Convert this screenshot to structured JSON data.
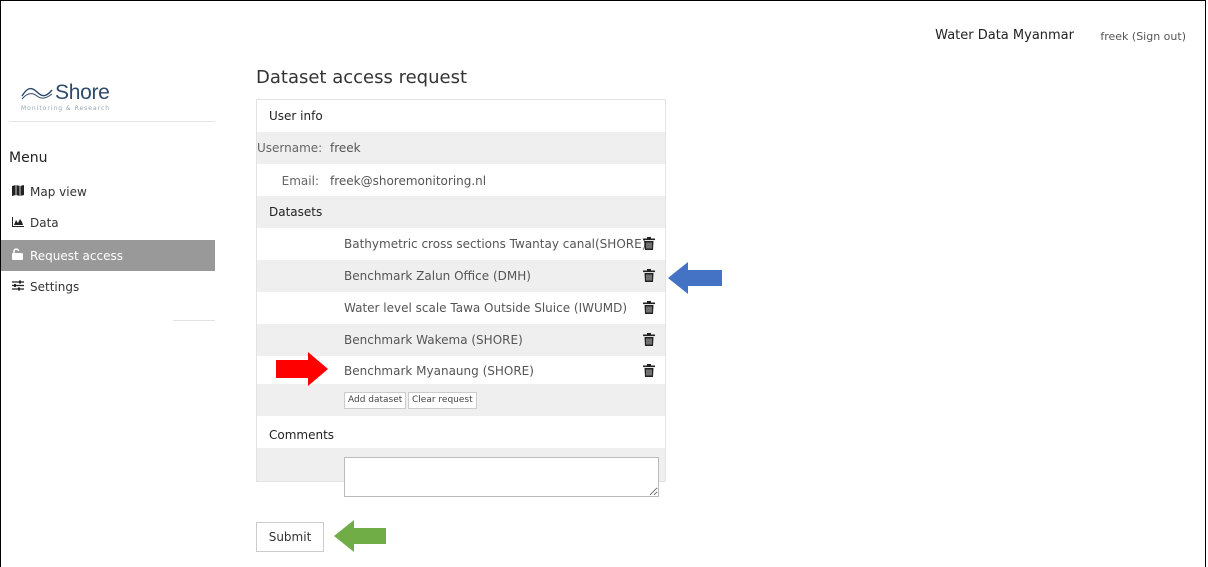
{
  "header": {
    "app_title": "Water Data Myanmar",
    "user_link": "freek (Sign out)"
  },
  "sidebar": {
    "logo_text": "Shore",
    "logo_sub": "Monitoring & Research",
    "menu_title": "Menu",
    "items": [
      {
        "label": "Map view",
        "icon": "map-icon",
        "active": false
      },
      {
        "label": "Data",
        "icon": "chart-icon",
        "active": false
      },
      {
        "label": "Request access",
        "icon": "unlock-icon",
        "active": true
      },
      {
        "label": "Settings",
        "icon": "sliders-icon",
        "active": false
      }
    ]
  },
  "main": {
    "page_title": "Dataset access request",
    "user_info": {
      "heading": "User info",
      "username_label": "Username:",
      "username": "freek",
      "email_label": "Email:",
      "email": "freek@shoremonitoring.nl"
    },
    "datasets": {
      "heading": "Datasets",
      "items": [
        "Bathymetric cross sections Twantay canal(SHORE)",
        "Benchmark Zalun Office (DMH)",
        "Water level scale Tawa Outside Sluice (IWUMD)",
        "Benchmark Wakema (SHORE)",
        "Benchmark Myanaung (SHORE)"
      ],
      "add_label": "Add dataset",
      "clear_label": "Clear request"
    },
    "comments": {
      "heading": "Comments",
      "value": ""
    },
    "submit_label": "Submit"
  },
  "annotations": {
    "blue_arrow_color": "#4472c4",
    "red_arrow_color": "#ff0000",
    "green_arrow_color": "#70ad47"
  }
}
